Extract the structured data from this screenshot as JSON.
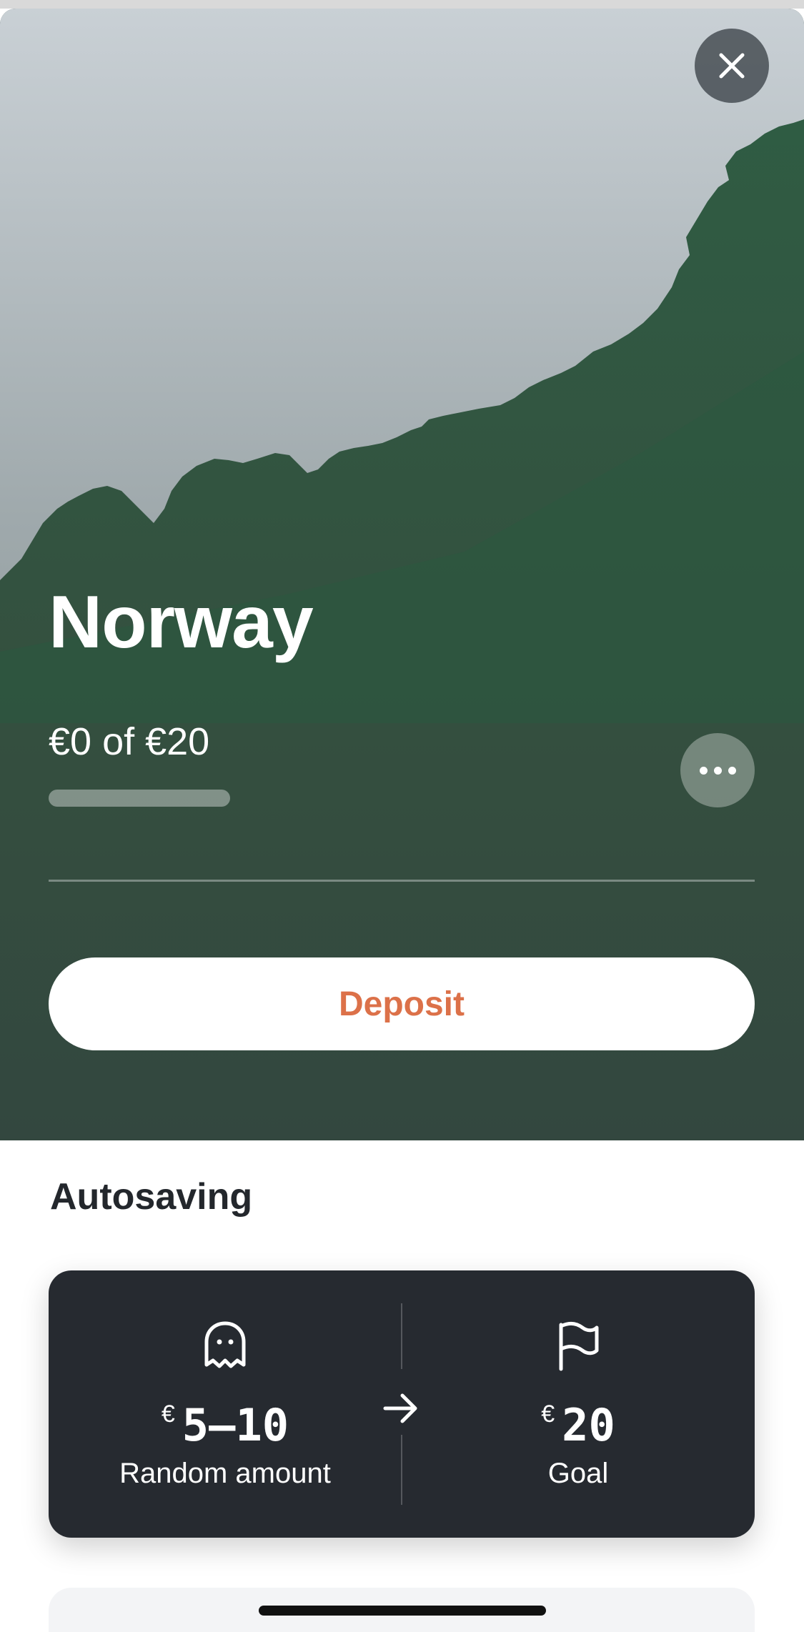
{
  "goal": {
    "title": "Norway",
    "progress_text": "€0 of €20",
    "progress_fraction": 0.0,
    "deposit_label": "Deposit"
  },
  "icons": {
    "close": "close-icon",
    "more": "more-horizontal-icon",
    "ghost": "ghost-icon",
    "flag": "flag-icon",
    "arrow": "arrow-right-icon"
  },
  "autosaving": {
    "title": "Autosaving",
    "source": {
      "currency": "€",
      "amount": "5–10",
      "label": "Random amount"
    },
    "target": {
      "currency": "€",
      "amount": "20",
      "label": "Goal"
    }
  },
  "colors": {
    "hero_bg": "#33473f",
    "accent": "#dc7149",
    "card_bg": "#262a30"
  }
}
